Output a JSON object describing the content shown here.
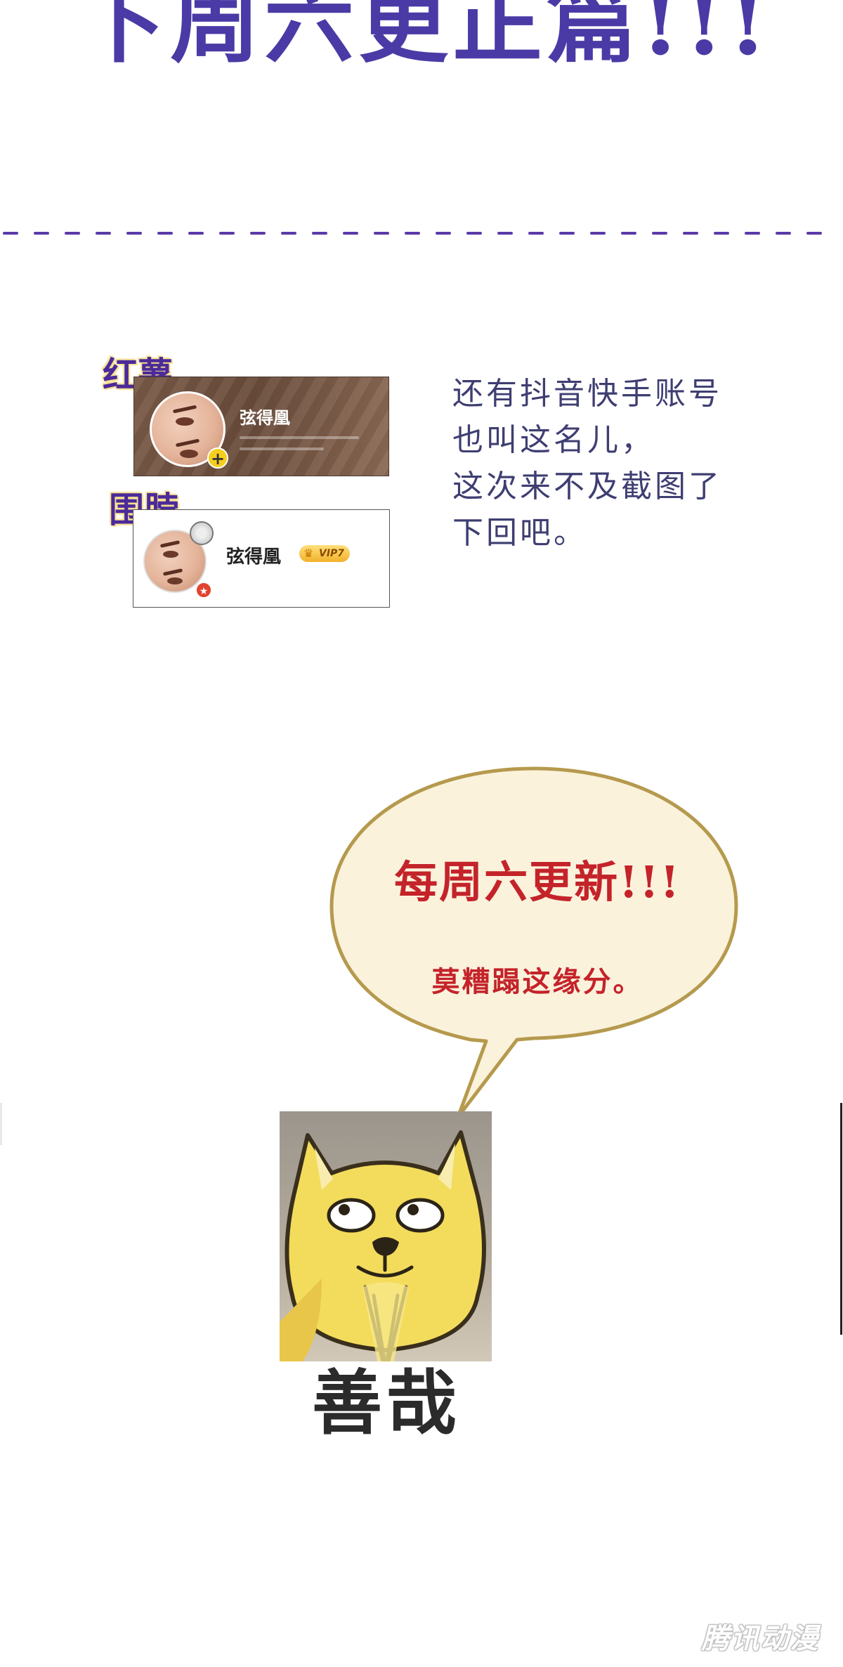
{
  "header": {
    "banner_text": "下周六更正篇!!!"
  },
  "profiles": [
    {
      "platform_label": "红薯",
      "display_name": "弦得凰"
    },
    {
      "platform_label": "围脖",
      "display_name": "弦得凰",
      "vip_badge": "VIP7"
    }
  ],
  "note": {
    "lines": [
      "还有抖音快手账号",
      "也叫这名儿，",
      "这次来不及截图了",
      "下回吧。"
    ]
  },
  "speech_bubble": {
    "title": "每周六更新!!!",
    "subtitle": "莫糟蹋这缘分。"
  },
  "meme": {
    "caption": "善哉",
    "image": "doge-praying-meme"
  },
  "watermark": {
    "text": "腾讯动漫"
  },
  "colors": {
    "banner": "#4a3aa6",
    "divider": "#5b3aa8",
    "label": "#4b2a9a",
    "note": "#3e3e72",
    "bubble_text": "#c4232a",
    "bubble_border": "#b59a4e",
    "bubble_fill": "#fbf2dc"
  }
}
